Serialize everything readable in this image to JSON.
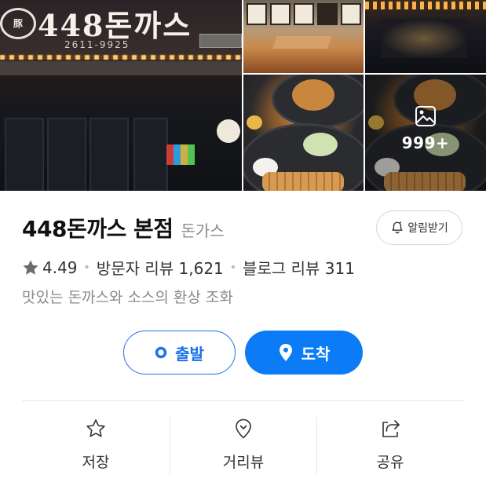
{
  "gallery": {
    "storefront_sign": "448돈까스",
    "storefront_logo": "豚",
    "storefront_phone": "2611-9925",
    "more_photos_count": "999+"
  },
  "place": {
    "name": "448돈까스 본점",
    "category": "돈가스",
    "notify_label": "알림받기",
    "rating": "4.49",
    "visitor_reviews": "방문자 리뷰 1,621",
    "blog_reviews": "블로그 리뷰 311",
    "description": "맛있는 돈까스와 소스의 환상 조화"
  },
  "route": {
    "depart_label": "출발",
    "arrive_label": "도착"
  },
  "actions": {
    "save_label": "저장",
    "street_view_label": "거리뷰",
    "share_label": "공유"
  },
  "colors": {
    "primary": "#0b7cf5",
    "accent_outline": "#1a73e8",
    "muted_text": "#8a8a8a"
  }
}
